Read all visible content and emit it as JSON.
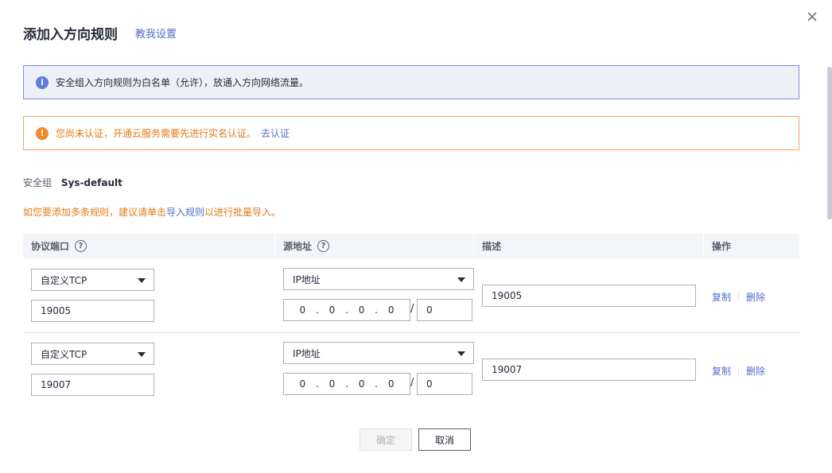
{
  "dialog": {
    "title": "添加入方向规则",
    "help_link": "教我设置",
    "close_icon": "close-icon"
  },
  "info_alert": {
    "icon": "info-icon",
    "text": "安全组入方向规则为白名单（允许），放通入方向网络流量。"
  },
  "warn_alert": {
    "icon": "warning-icon",
    "text": "您尚未认证，开通云服务需要先进行实名认证。",
    "link": "去认证"
  },
  "security_group": {
    "label": "安全组",
    "value": "Sys-default"
  },
  "batch_tip": {
    "prefix": "如您要添加多条规则，建议请单击",
    "link": "导入规则",
    "suffix": "以进行批量导入。"
  },
  "table": {
    "headers": {
      "protocol_port": "协议端口",
      "source": "源地址",
      "description": "描述",
      "actions": "操作"
    },
    "help_glyph": "?",
    "rows": [
      {
        "protocol": "自定义TCP",
        "port": "19005",
        "source_type": "IP地址",
        "ip": [
          "0",
          "0",
          "0",
          "0"
        ],
        "mask": "0",
        "description": "19005",
        "copy": "复制",
        "delete": "删除"
      },
      {
        "protocol": "自定义TCP",
        "port": "19007",
        "source_type": "IP地址",
        "ip": [
          "0",
          "0",
          "0",
          "0"
        ],
        "mask": "0",
        "description": "19007",
        "copy": "复制",
        "delete": "删除"
      }
    ]
  },
  "footer": {
    "ok": "确定",
    "cancel": "取消"
  },
  "colors": {
    "accent": "#526ecc",
    "warning": "#e47a18",
    "info_bg": "#eef0f8"
  }
}
